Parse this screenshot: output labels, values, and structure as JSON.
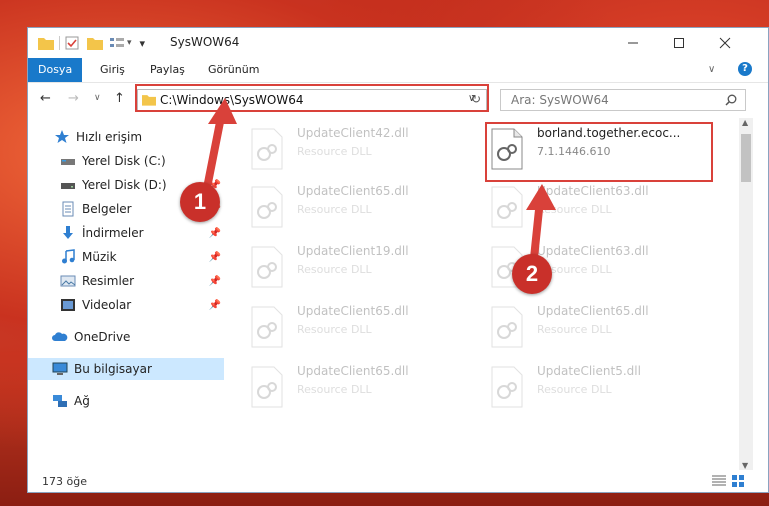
{
  "window": {
    "title": "SysWOW64"
  },
  "ribbon": {
    "tabs": [
      "Dosya",
      "Giriş",
      "Paylaş",
      "Görünüm"
    ]
  },
  "address": {
    "path": "C:\\Windows\\SysWOW64"
  },
  "search": {
    "placeholder": "Ara: SysWOW64"
  },
  "sidebar": {
    "items": [
      {
        "label": "Hızlı erişim",
        "icon": "star-icon"
      },
      {
        "label": "Yerel Disk (C:)",
        "icon": "drive-icon"
      },
      {
        "label": "Yerel Disk (D:)",
        "icon": "drive-icon"
      },
      {
        "label": "Belgeler",
        "icon": "documents-icon"
      },
      {
        "label": "İndirmeler",
        "icon": "download-icon"
      },
      {
        "label": "Müzik",
        "icon": "music-icon"
      },
      {
        "label": "Resimler",
        "icon": "pictures-icon"
      },
      {
        "label": "Videolar",
        "icon": "videos-icon"
      },
      {
        "label": "OneDrive",
        "icon": "cloud-icon"
      },
      {
        "label": "Bu bilgisayar",
        "icon": "computer-icon"
      },
      {
        "label": "Ağ",
        "icon": "network-icon"
      }
    ]
  },
  "files": [
    {
      "name": "UpdateClient42.dll",
      "type": "Resource DLL"
    },
    {
      "name": "borland.together.ecoc...",
      "type": "7.1.1446.610"
    },
    {
      "name": "UpdateClient65.dll",
      "type": "Resource DLL"
    },
    {
      "name": "UpdateClient63.dll",
      "type": "Resource DLL"
    },
    {
      "name": "UpdateClient19.dll",
      "type": "Resource DLL"
    },
    {
      "name": "UpdateClient63.dll",
      "type": "Resource DLL"
    },
    {
      "name": "UpdateClient65.dll",
      "type": "Resource DLL"
    },
    {
      "name": "UpdateClient65.dll",
      "type": "Resource DLL"
    },
    {
      "name": "UpdateClient65.dll",
      "type": "Resource DLL"
    },
    {
      "name": "UpdateClient5.dll",
      "type": "Resource DLL"
    }
  ],
  "status": {
    "count": "173 öğe"
  },
  "annotations": {
    "step1": "1",
    "step2": "2"
  },
  "colors": {
    "accent": "#1979ca",
    "highlight": "#d9413a"
  }
}
